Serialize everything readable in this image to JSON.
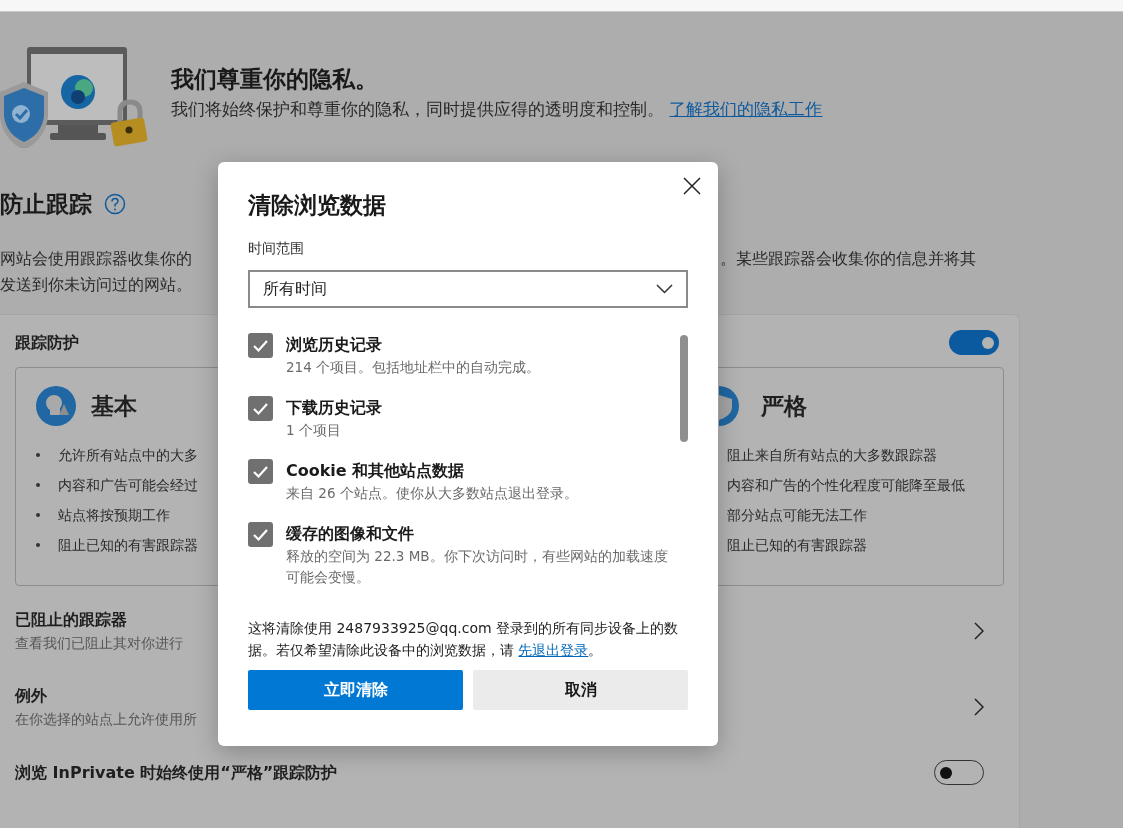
{
  "header": {
    "title": "我们尊重你的隐私。",
    "description": "我们将始终保护和尊重你的隐私，同时提供应得的透明度和控制。",
    "link": "了解我们的隐私工作"
  },
  "tracking": {
    "title": "防止跟踪",
    "description_left": "网站会使用跟踪器收集你的",
    "description_right": "。某些跟踪器会收集你的信息并将其",
    "description_line2": "发送到你未访问过的网站。"
  },
  "card": {
    "title": "跟踪防护",
    "on": true,
    "options": [
      {
        "title": "基本",
        "bullets": [
          "允许所有站点中的大多",
          "内容和广告可能会经过",
          "站点将按预期工作",
          "阻止已知的有害跟踪器"
        ]
      },
      {
        "title": "严格",
        "bullets": [
          "阻止来自所有站点的大多数跟踪器",
          "内容和广告的个性化程度可能降至最低",
          "部分站点可能无法工作",
          "阻止已知的有害跟踪器"
        ]
      }
    ],
    "rows": [
      {
        "kind": "link",
        "title": "已阻止的跟踪器",
        "subtitle": "查看我们已阻止其对你进行"
      },
      {
        "kind": "link",
        "title": "例外",
        "subtitle": "在你选择的站点上允许使用所"
      },
      {
        "kind": "toggle",
        "title": "浏览 InPrivate 时始终使用“严格”跟踪防护",
        "on": false
      }
    ]
  },
  "dialog": {
    "title": "清除浏览数据",
    "range_label": "时间范围",
    "range_value": "所有时间",
    "items": [
      {
        "title": "浏览历史记录",
        "detail": "214 个项目。包括地址栏中的自动完成。",
        "checked": true
      },
      {
        "title": "下载历史记录",
        "detail": "1 个项目",
        "checked": true
      },
      {
        "title": "Cookie 和其他站点数据",
        "detail": "来自 26 个站点。使你从大多数站点退出登录。",
        "checked": true
      },
      {
        "title": "缓存的图像和文件",
        "detail": "释放的空间为 22.3 MB。你下次访问时，有些网站的加载速度可能会变慢。",
        "checked": true
      }
    ],
    "note": "这将清除使用 2487933925@qq.com 登录到的所有同步设备上的数据。若仅希望清除此设备中的浏览数据，请",
    "note_link": "先退出登录",
    "note_end": "。",
    "primary_button": "立即清除",
    "secondary_button": "取消"
  }
}
